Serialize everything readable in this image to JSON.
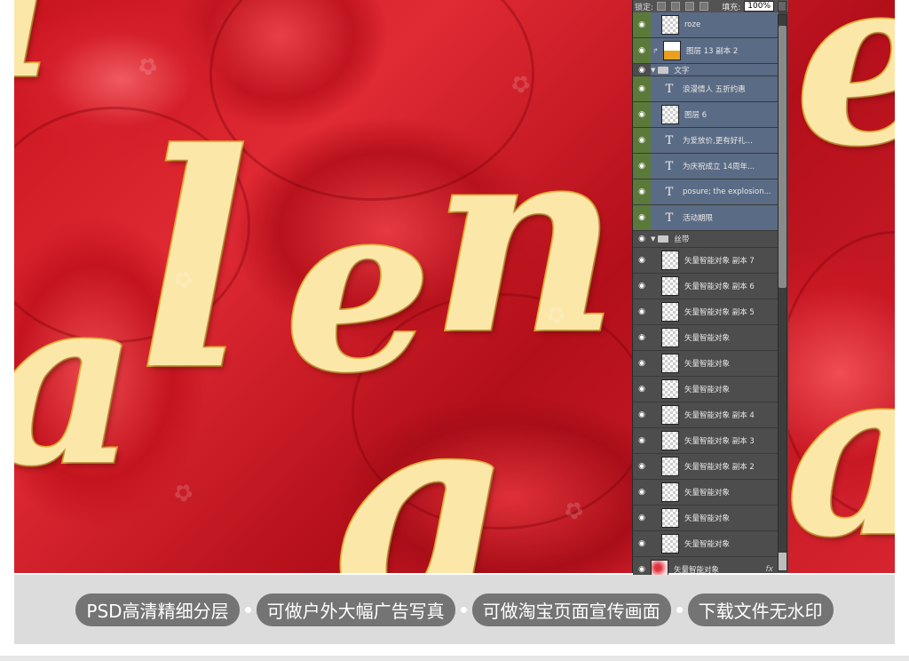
{
  "canvas": {
    "script_letters": [
      "a",
      "l",
      "e",
      "n",
      "a",
      "a",
      "e",
      "i"
    ]
  },
  "layers_panel": {
    "lock_label": "锁定:",
    "fill_label": "填充:",
    "fill_value": "100%",
    "layers": [
      {
        "name": "roze",
        "type": "pixel",
        "thumb": "checker",
        "selected": true
      },
      {
        "name": "图层 13 副本 2",
        "type": "pixel",
        "thumb": "image",
        "selected": true,
        "linked": true
      },
      {
        "name": "文字",
        "type": "group",
        "selected": true
      },
      {
        "name": "浪漫情人 五折约惠",
        "type": "text",
        "selected": true
      },
      {
        "name": "图层 6",
        "type": "pixel",
        "thumb": "checker",
        "selected": true
      },
      {
        "name": "为爱放价,更有好礼...",
        "type": "text",
        "selected": true
      },
      {
        "name": "为庆祝成立 14周年...",
        "type": "text",
        "selected": true
      },
      {
        "name": "posure; the explosion...",
        "type": "text",
        "selected": true
      },
      {
        "name": "活动期限",
        "type": "text",
        "selected": true
      },
      {
        "name": "丝带",
        "type": "group",
        "selected": false
      },
      {
        "name": "矢量智能对象 副本 7",
        "type": "smart",
        "selected": false
      },
      {
        "name": "矢量智能对象 副本 6",
        "type": "smart",
        "selected": false
      },
      {
        "name": "矢量智能对象 副本 5",
        "type": "smart",
        "selected": false
      },
      {
        "name": "矢量智能对象",
        "type": "smart",
        "selected": false
      },
      {
        "name": "矢量智能对象",
        "type": "smart",
        "selected": false
      },
      {
        "name": "矢量智能对象",
        "type": "smart",
        "selected": false
      },
      {
        "name": "矢量智能对象 副本 4",
        "type": "smart",
        "selected": false
      },
      {
        "name": "矢量智能对象 副本 3",
        "type": "smart",
        "selected": false
      },
      {
        "name": "矢量智能对象 副本 2",
        "type": "smart",
        "selected": false
      },
      {
        "name": "矢量智能对象",
        "type": "smart",
        "selected": false
      },
      {
        "name": "矢量智能对象",
        "type": "smart",
        "selected": false
      },
      {
        "name": "矢量智能对象",
        "type": "smart",
        "selected": false
      },
      {
        "name": "矢量智能对象",
        "type": "smart",
        "thumb": "petal",
        "selected": false,
        "fx": "fx"
      }
    ]
  },
  "features": [
    "PSD高清精细分层",
    "可做户外大幅广告写真",
    "可做淘宝页面宣传画面",
    "下载文件无水印"
  ],
  "colors": {
    "rose_red": "#c8141f",
    "gold_fill": "#fbe7a8",
    "gold_stroke": "#d9a21e",
    "panel_bg": "#4d4d4d",
    "pill_bg": "#747474",
    "band_bg": "#dcdcdc"
  }
}
